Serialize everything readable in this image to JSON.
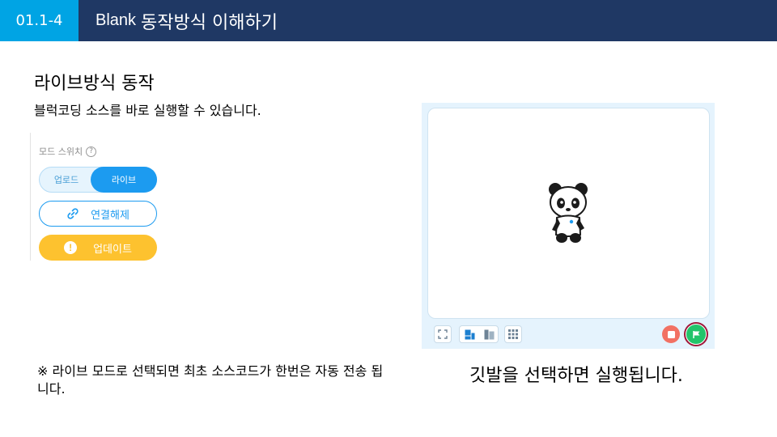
{
  "header": {
    "section_number": "01.1-4",
    "title_latin": "Blank",
    "title_korean": "동작방식 이해하기"
  },
  "heading": "라이브방식 동작",
  "subheading": "블럭코딩 소스를 바로 실행할 수 있습니다.",
  "panel": {
    "mode_switch_label": "모드 스위치",
    "help_icon": "?",
    "toggle": {
      "upload_label": "업로드",
      "live_label": "라이브",
      "selected": "라이브"
    },
    "disconnect_label": "연결해제",
    "update_label": "업데이트",
    "update_icon": "!"
  },
  "stage": {
    "sprite": "panda",
    "icons": [
      "fullscreen-icon",
      "small-stage-layout-icon",
      "large-stage-layout-icon",
      "grid-icon",
      "stop-icon",
      "green-flag-icon"
    ]
  },
  "note": "※ 라이브 모드로 선택되면 최초 소스코드가 한번은 자동 전송 됩니다.",
  "caption": "깃발을 선택하면 실행됩니다.",
  "colors": {
    "header_bg": "#1f3864",
    "badge_bg": "#00a4e4",
    "live_blue": "#1c9bf0",
    "update_yellow": "#fdc22f",
    "stop_red": "#f27163",
    "flag_green": "#22c46a",
    "highlight_ring": "#a0183a"
  }
}
